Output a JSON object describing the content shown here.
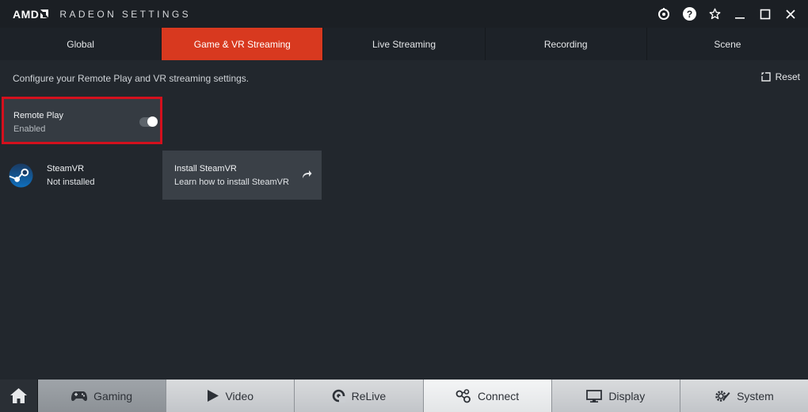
{
  "window": {
    "brand": "AMD",
    "title": "RADEON SETTINGS"
  },
  "tabs": [
    {
      "label": "Global",
      "active": false
    },
    {
      "label": "Game & VR Streaming",
      "active": true
    },
    {
      "label": "Live Streaming",
      "active": false
    },
    {
      "label": "Recording",
      "active": false
    },
    {
      "label": "Scene",
      "active": false
    }
  ],
  "subheader": {
    "description": "Configure your Remote Play and VR streaming settings.",
    "reset_label": "Reset"
  },
  "remote_play": {
    "title": "Remote Play",
    "status": "Enabled",
    "toggle_on": true
  },
  "steamvr": {
    "title": "SteamVR",
    "status": "Not installed"
  },
  "install_steamvr": {
    "title": "Install SteamVR",
    "subtitle": "Learn how to install SteamVR"
  },
  "bottom_nav": [
    {
      "label": "Gaming",
      "icon": "gamepad-icon"
    },
    {
      "label": "Video",
      "icon": "play-icon"
    },
    {
      "label": "ReLive",
      "icon": "relive-icon"
    },
    {
      "label": "Connect",
      "icon": "connect-icon",
      "active": true
    },
    {
      "label": "Display",
      "icon": "display-icon"
    },
    {
      "label": "System",
      "icon": "system-gear-icon"
    }
  ],
  "colors": {
    "accent": "#d8391f",
    "highlight_border": "#d4101d",
    "background": "#22272d"
  }
}
